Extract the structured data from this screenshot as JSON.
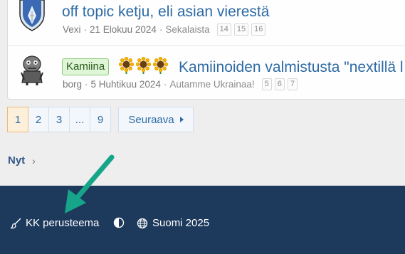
{
  "threads": [
    {
      "title": "off topic ketju, eli asian vierestä",
      "author": "Vexi",
      "date": "21 Elokuu 2024",
      "forum": "Sekalaista",
      "pages": [
        "14",
        "15",
        "16"
      ]
    },
    {
      "prefix": "Kamiina",
      "title": "Kamiinoiden valmistusta \"nextillä l",
      "author": "borg",
      "date": "5 Huhtikuu 2024",
      "forum": "Autamme Ukrainaa!",
      "pages": [
        "5",
        "6",
        "7"
      ]
    }
  ],
  "meta_separator": "·",
  "pagination": {
    "pages": [
      "1",
      "2",
      "3",
      "...",
      "9"
    ],
    "current": "1",
    "next_label": "Seuraava"
  },
  "breadcrumb": {
    "label": "Nyt",
    "chevron": "›"
  },
  "footer": {
    "style_label": "KK perusteema",
    "language_label": "Suomi 2025"
  },
  "colors": {
    "link": "#2d6aa4",
    "footer_bg": "#1d3a5d",
    "prefix_bg": "#dff6d6",
    "annotation_arrow": "#17a589"
  },
  "icons": {
    "thread1_avatar": "coat-of-arms-icon",
    "thread2_avatar": "creature-avatar-icon",
    "sunflower": "sunflower-icon",
    "style": "paintbrush-icon",
    "theme": "half-circle-contrast-icon",
    "language": "globe-icon"
  }
}
